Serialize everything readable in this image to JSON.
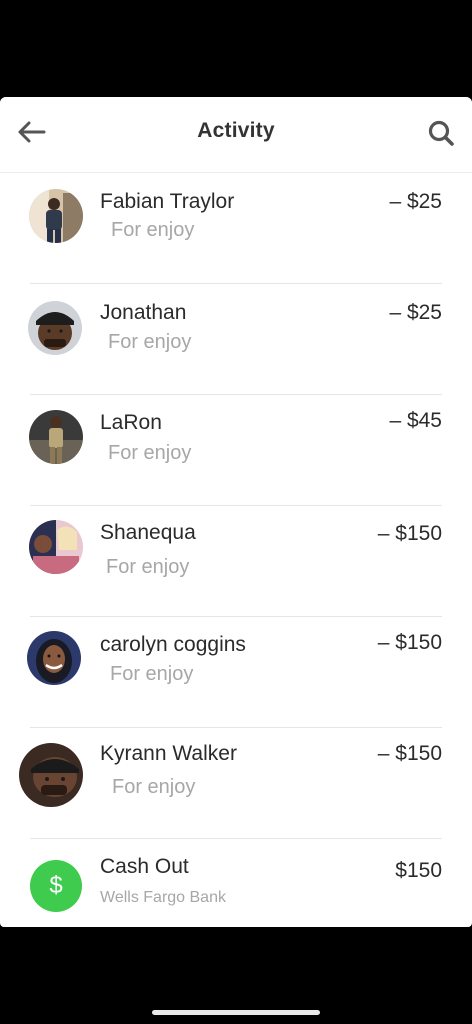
{
  "header": {
    "title": "Activity",
    "back_icon": "arrow-left-icon",
    "search_icon": "search-icon"
  },
  "transactions": [
    {
      "name": "Fabian Traylor",
      "note": "For enjoy",
      "amount": "– $25"
    },
    {
      "name": "Jonathan",
      "note": "For enjoy",
      "amount": "– $25"
    },
    {
      "name": "LaRon",
      "note": "For enjoy",
      "amount": "– $45"
    },
    {
      "name": "Shanequa",
      "note": "For enjoy",
      "amount": "– $150"
    },
    {
      "name": "carolyn coggins",
      "note": "For enjoy",
      "amount": "– $150"
    },
    {
      "name": "Kyrann Walker",
      "note": "For enjoy",
      "amount": "– $150"
    }
  ],
  "cashout": {
    "name": "Cash Out",
    "bank": "Wells Fargo Bank",
    "amount": "$150",
    "icon": "dollar-icon",
    "icon_symbol": "$",
    "icon_color": "#3fcc4e"
  }
}
